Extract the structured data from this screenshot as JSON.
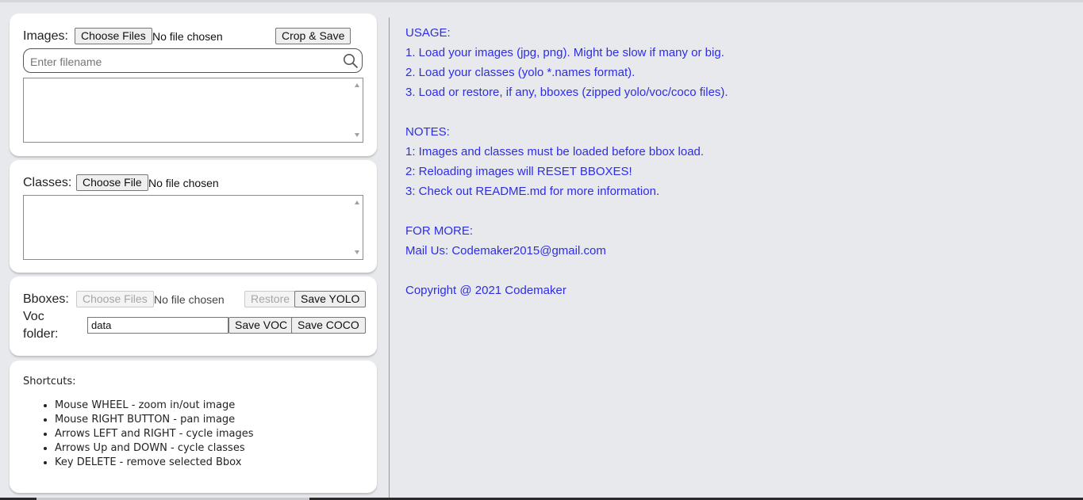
{
  "images": {
    "label": "Images:",
    "choose_label": "Choose Files",
    "status": "No file chosen",
    "crop_save_label": "Crop & Save",
    "search_placeholder": "Enter filename"
  },
  "classes": {
    "label": "Classes:",
    "choose_label": "Choose File",
    "status": "No file chosen"
  },
  "bboxes": {
    "label": "Bboxes:",
    "choose_label": "Choose Files",
    "status": "No file chosen",
    "restore_label": "Restore",
    "save_yolo_label": "Save YOLO",
    "voc_label_line1": "Voc",
    "voc_label_line2": "folder:",
    "voc_folder_value": "data",
    "save_voc_label": "Save VOC",
    "save_coco_label": "Save COCO"
  },
  "shortcuts": {
    "title": "Shortcuts:",
    "items": [
      "Mouse WHEEL - zoom in/out image",
      "Mouse RIGHT BUTTON - pan image",
      "Arrows LEFT and RIGHT - cycle images",
      "Arrows Up and DOWN - cycle classes",
      "Key DELETE - remove selected Bbox"
    ]
  },
  "info": {
    "usage_title": "USAGE:",
    "usage": [
      "1. Load your images (jpg, png). Might be slow if many or big.",
      "2. Load your classes (yolo *.names format).",
      "3. Load or restore, if any, bboxes (zipped yolo/voc/coco files)."
    ],
    "notes_title": "NOTES:",
    "notes": [
      "1: Images and classes must be loaded before bbox load.",
      "2: Reloading images will RESET BBOXES!",
      "3: Check out README.md for more information."
    ],
    "more_title": "FOR MORE:",
    "mail": "Mail Us: Codemaker2015@gmail.com",
    "copyright": "Copyright @ 2021 Codemaker"
  },
  "colors": {
    "info_text": "#2d2de6",
    "background": "#e8e9ec"
  },
  "icons": {
    "search": "search-icon"
  }
}
